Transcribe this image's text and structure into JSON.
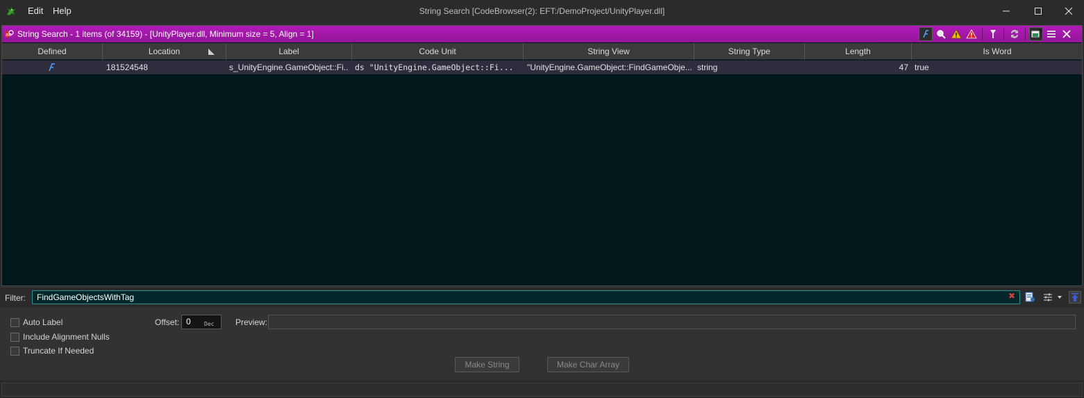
{
  "window": {
    "title": "String Search [CodeBrowser(2): EFT:/DemoProject/UnityPlayer.dll]",
    "menu": [
      {
        "label": "Edit"
      },
      {
        "label": "Help"
      }
    ]
  },
  "component": {
    "title": "String Search - 1 items (of 34159) - [UnityPlayer.dll, Minimum size = 5, Align = 1]",
    "title_color": "#a31aab"
  },
  "table": {
    "columns": [
      {
        "label": "Defined"
      },
      {
        "label": "Location"
      },
      {
        "label": "Label"
      },
      {
        "label": "Code Unit"
      },
      {
        "label": "String View"
      },
      {
        "label": "String Type"
      },
      {
        "label": "Length"
      },
      {
        "label": "Is Word"
      }
    ],
    "rows": [
      {
        "defined_icon": "defined-string-icon",
        "location": "181524548",
        "label": "s_UnityEngine.GameObject::Fi...",
        "code_unit": "ds \"UnityEngine.GameObject::Fi...",
        "string_view": "\"UnityEngine.GameObject::FindGameObje...",
        "string_type": "string",
        "length": "47",
        "is_word": "true"
      }
    ]
  },
  "filter": {
    "label": "Filter:",
    "value": "FindGameObjectsWithTag"
  },
  "options": {
    "auto_label": "Auto Label",
    "include_alignment_nulls": "Include Alignment Nulls",
    "truncate_if_needed": "Truncate If Needed",
    "offset_label": "Offset:",
    "offset_value": "0",
    "offset_unit": "Dec",
    "preview_label": "Preview:",
    "make_string": "Make String",
    "make_char_array": "Make Char Array"
  }
}
